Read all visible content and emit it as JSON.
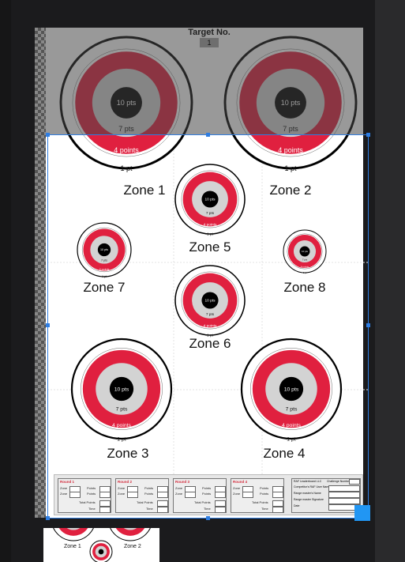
{
  "header": {
    "title": "Target No.",
    "number": "1"
  },
  "targets": {
    "labels": {
      "ten": "10 pts",
      "seven": "7 pts",
      "four": "4 points",
      "one": "1 pt"
    },
    "zones": [
      {
        "id": "zone-1",
        "label": "Zone 1"
      },
      {
        "id": "zone-2",
        "label": "Zone 2"
      },
      {
        "id": "zone-5",
        "label": "Zone 5"
      },
      {
        "id": "zone-7",
        "label": "Zone 7"
      },
      {
        "id": "zone-8",
        "label": "Zone 8"
      },
      {
        "id": "zone-6",
        "label": "Zone 6"
      },
      {
        "id": "zone-3",
        "label": "Zone 3"
      },
      {
        "id": "zone-4",
        "label": "Zone 4"
      }
    ],
    "colors": {
      "red": "#e0203f",
      "grey": "#d3d3d3",
      "black": "#000000"
    }
  },
  "scorecard": {
    "rounds": [
      {
        "title": "Round 1"
      },
      {
        "title": "Round 2"
      },
      {
        "title": "Round 3"
      },
      {
        "title": "Round 4"
      }
    ],
    "row_labels": {
      "zone": "Zone",
      "points": "Points",
      "total": "Total Points",
      "time": "Time"
    },
    "info": {
      "left_label": "RAF Leaderboard LLC",
      "right_label": "Challenge Number",
      "fields": [
        "Competitor's RAF User Name",
        "Range master's Name",
        "Range master Signature",
        "Date"
      ]
    }
  },
  "thumbnail": {
    "zone1": "Zone 1",
    "zone2": "Zone 2"
  },
  "ui": {
    "selection_color": "#2f7de1",
    "corner_color": "#2196f3"
  }
}
